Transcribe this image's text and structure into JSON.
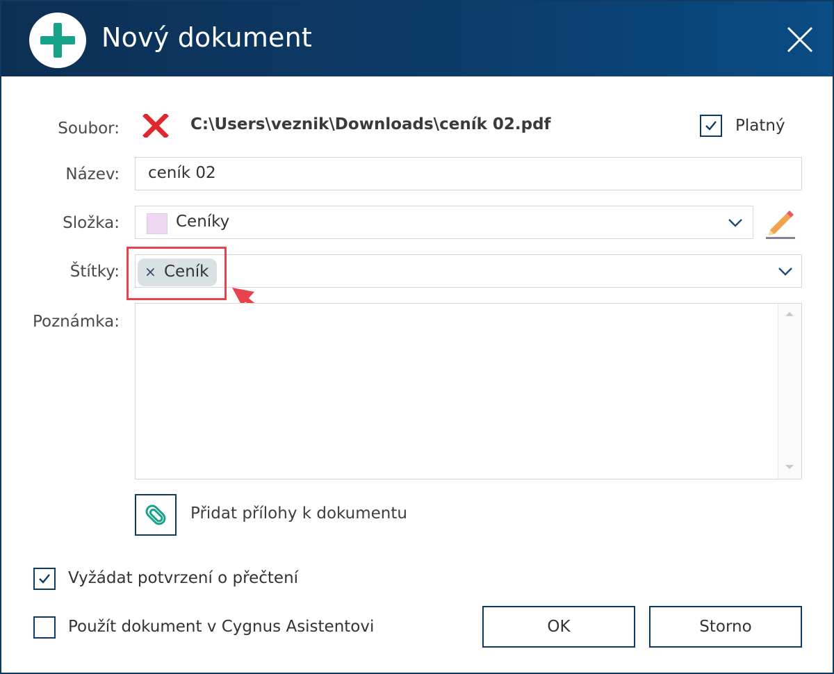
{
  "window": {
    "title": "Nový dokument",
    "app_icon": "plus-circle-icon",
    "close_icon": "close-icon",
    "titlebar_color": "#0b3d6b",
    "accent_color": "#17a38a"
  },
  "form": {
    "file": {
      "label": "Soubor:",
      "status_icon": "red-x-icon",
      "path": "C:\\Users\\veznik\\Downloads\\ceník 02.pdf"
    },
    "valid": {
      "label": "Platný",
      "checked": true
    },
    "name": {
      "label": "Název:",
      "value": "ceník 02"
    },
    "folder": {
      "label": "Složka:",
      "value": "Ceníky",
      "swatch_color": "#efd6f2",
      "edit_icon": "pencil-icon"
    },
    "tags": {
      "label": "Štítky:",
      "items": [
        {
          "text": "Ceník",
          "remove": "×"
        }
      ]
    },
    "note": {
      "label": "Poznámka:",
      "value": ""
    },
    "attachments": {
      "label": "Přidat přílohy k dokumentu",
      "icon": "paperclip-icon"
    }
  },
  "options": {
    "read_receipt": {
      "label": "Vyžádat potvrzení o přečtení",
      "checked": true
    },
    "use_in_assistant": {
      "label": "Použít dokument v Cygnus Asistentovi",
      "checked": false
    }
  },
  "buttons": {
    "ok": "OK",
    "cancel": "Storno"
  },
  "annotation": {
    "highlight_color": "#e8434d"
  }
}
